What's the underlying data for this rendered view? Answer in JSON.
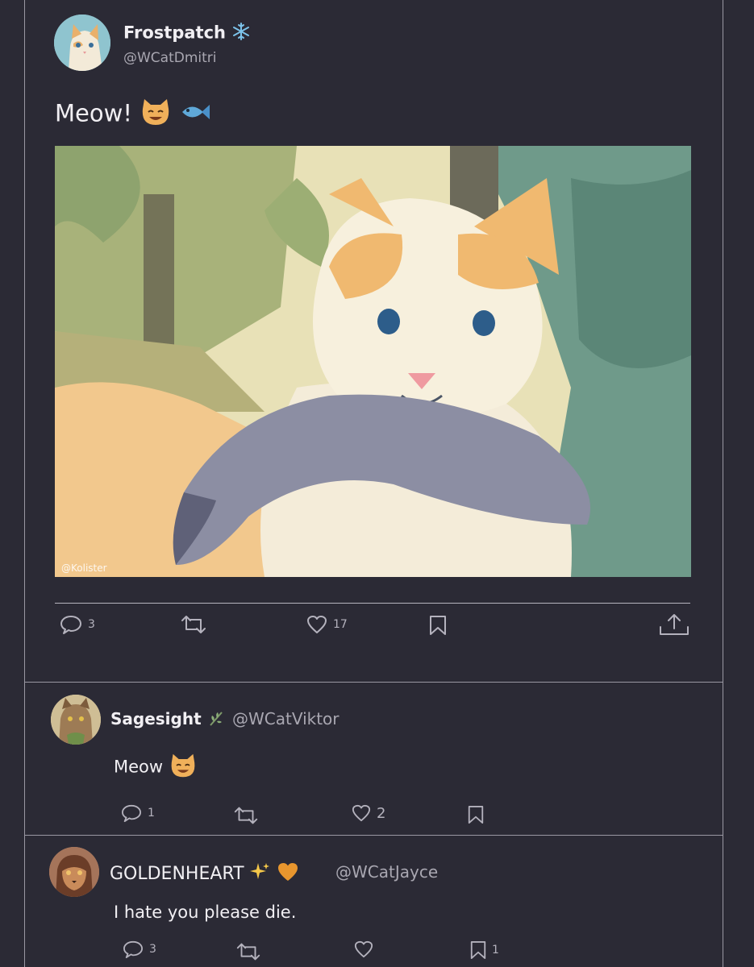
{
  "post": {
    "display_name": "Frostpatch",
    "name_emoji": "snowflake-icon",
    "handle": "@WCatDmitri",
    "text": "Meow!",
    "text_emojis": [
      "cat-smile-icon",
      "fish-icon"
    ],
    "image_watermark": "@Kolister",
    "stats": {
      "replies": "3",
      "likes": "17"
    }
  },
  "replies": [
    {
      "display_name": "Sagesight",
      "name_emoji": "herb-icon",
      "handle": "@WCatViktor",
      "text": "Meow",
      "text_emoji": "cat-smile-icon",
      "stats": {
        "replies": "1",
        "likes": "2"
      }
    },
    {
      "display_name": "GOLDENHEART",
      "name_emojis": [
        "sparkles-icon",
        "orange-heart-icon"
      ],
      "handle": "@WCatJayce",
      "text": "I hate you please die.",
      "stats": {
        "replies": "3",
        "bookmarks": "1"
      }
    }
  ],
  "colors": {
    "background": "#2b2a35",
    "text": "#f1eff3",
    "muted": "#a9a7b1",
    "divider": "#9a98a3"
  }
}
